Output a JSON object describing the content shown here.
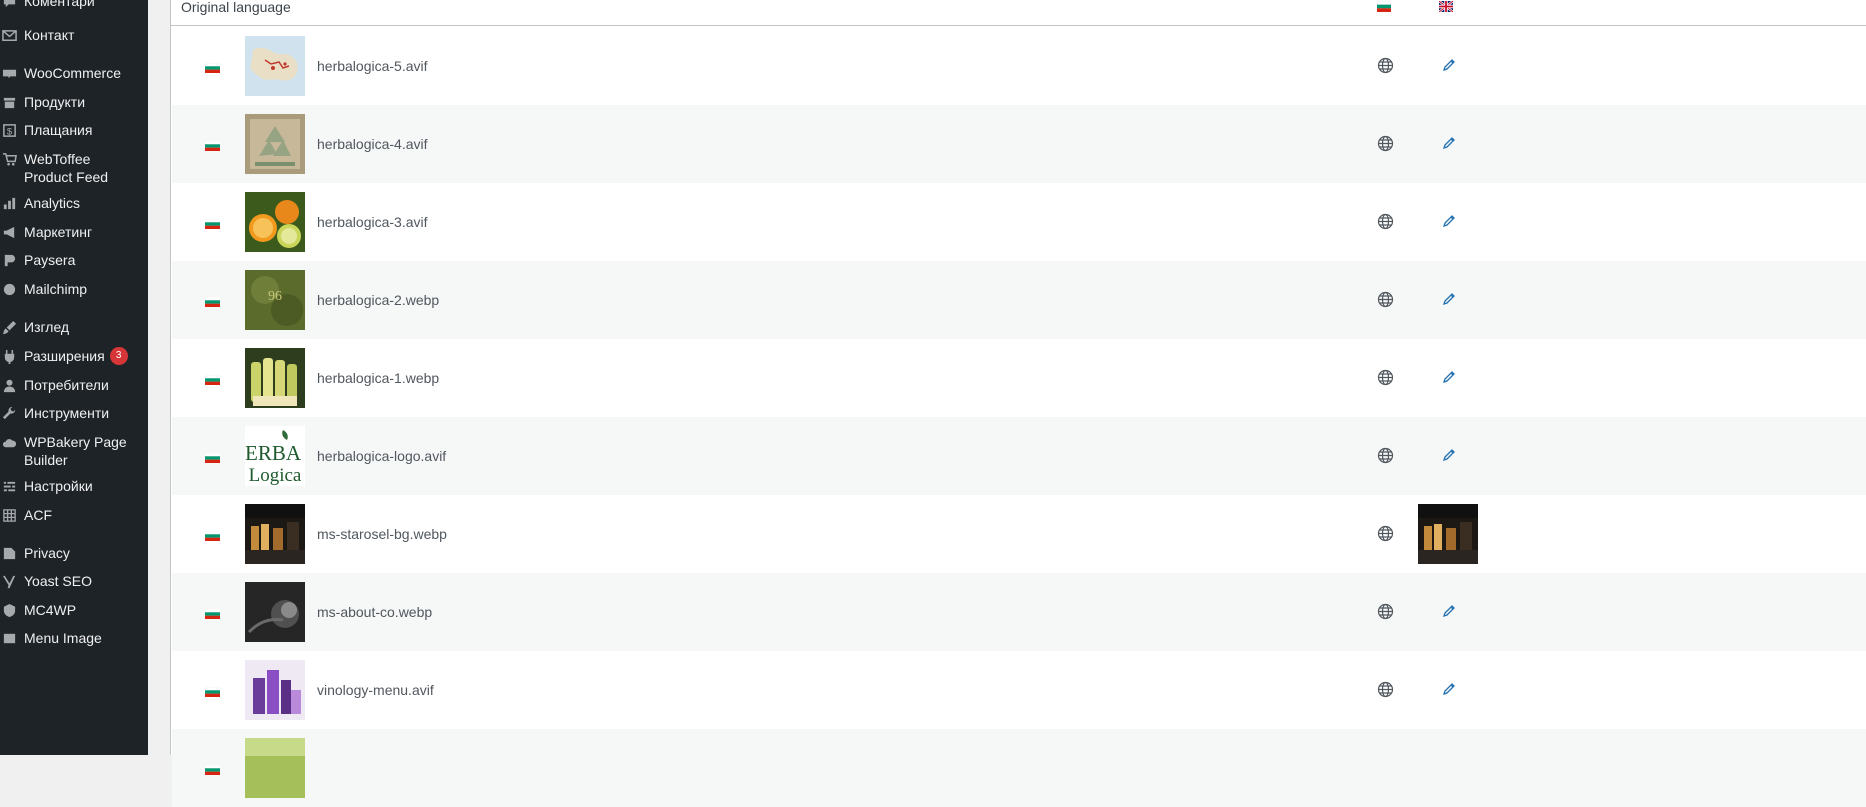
{
  "sidebar": {
    "items": [
      {
        "label": "Коментари",
        "icon": "comment-icon"
      },
      {
        "label": "Контакт",
        "icon": "mail-icon"
      },
      {
        "label": "WooCommerce",
        "icon": "woocommerce-icon"
      },
      {
        "label": "Продукти",
        "icon": "archive-icon"
      },
      {
        "label": "Плащания",
        "icon": "dollar-icon"
      },
      {
        "label": "WebToffee Product Feed",
        "icon": "cart-icon"
      },
      {
        "label": "Analytics",
        "icon": "bar-chart-icon"
      },
      {
        "label": "Маркетинг",
        "icon": "megaphone-icon"
      },
      {
        "label": "Paysera",
        "icon": "paysera-icon"
      },
      {
        "label": "Mailchimp",
        "icon": "mailchimp-icon"
      },
      {
        "label": "Изглед",
        "icon": "paintbrush-icon"
      },
      {
        "label": "Разширения",
        "icon": "plugin-icon",
        "badge": "3"
      },
      {
        "label": "Потребители",
        "icon": "user-icon"
      },
      {
        "label": "Инструменти",
        "icon": "wrench-icon"
      },
      {
        "label": "WPBakery Page Builder",
        "icon": "cloud-icon"
      },
      {
        "label": "Настройки",
        "icon": "settings-icon"
      },
      {
        "label": "ACF",
        "icon": "grid-icon"
      },
      {
        "label": "Privacy",
        "icon": "privacy-icon"
      },
      {
        "label": "Yoast SEO",
        "icon": "yoast-icon"
      },
      {
        "label": "MC4WP",
        "icon": "mc4wp-icon"
      },
      {
        "label": "Menu Image",
        "icon": "image-icon"
      }
    ]
  },
  "table": {
    "header": {
      "original_language": "Original language",
      "lang_flags": [
        "bg",
        "en"
      ]
    },
    "rows": [
      {
        "flag": "bg",
        "filename": "herbalogica-5.avif",
        "thumb": "map",
        "translation": "edit"
      },
      {
        "flag": "bg",
        "filename": "herbalogica-4.avif",
        "thumb": "recycle",
        "translation": "edit"
      },
      {
        "flag": "bg",
        "filename": "herbalogica-3.avif",
        "thumb": "citrus",
        "translation": "edit"
      },
      {
        "flag": "bg",
        "filename": "herbalogica-2.webp",
        "thumb": "olive",
        "translation": "edit"
      },
      {
        "flag": "bg",
        "filename": "herbalogica-1.webp",
        "thumb": "bottles",
        "translation": "edit"
      },
      {
        "flag": "bg",
        "filename": "herbalogica-logo.avif",
        "thumb": "logo",
        "logo_text": [
          "ERBA",
          "Logica"
        ],
        "translation": "edit"
      },
      {
        "flag": "bg",
        "filename": "ms-starosel-bg.webp",
        "thumb": "dark-products",
        "translation": "thumb"
      },
      {
        "flag": "bg",
        "filename": "ms-about-co.webp",
        "thumb": "dark-flower",
        "translation": "edit"
      },
      {
        "flag": "bg",
        "filename": "vinology-menu.avif",
        "thumb": "purple",
        "translation": "edit"
      },
      {
        "flag": "bg",
        "filename": "",
        "thumb": "green",
        "translation": "none"
      }
    ]
  },
  "colors": {
    "sidebar_bg": "#1d2327",
    "edit_icon": "#2271b1",
    "badge": "#d63638",
    "bg_white": "#ffffff",
    "bg_green": "#00966e",
    "bg_red": "#d62612"
  }
}
